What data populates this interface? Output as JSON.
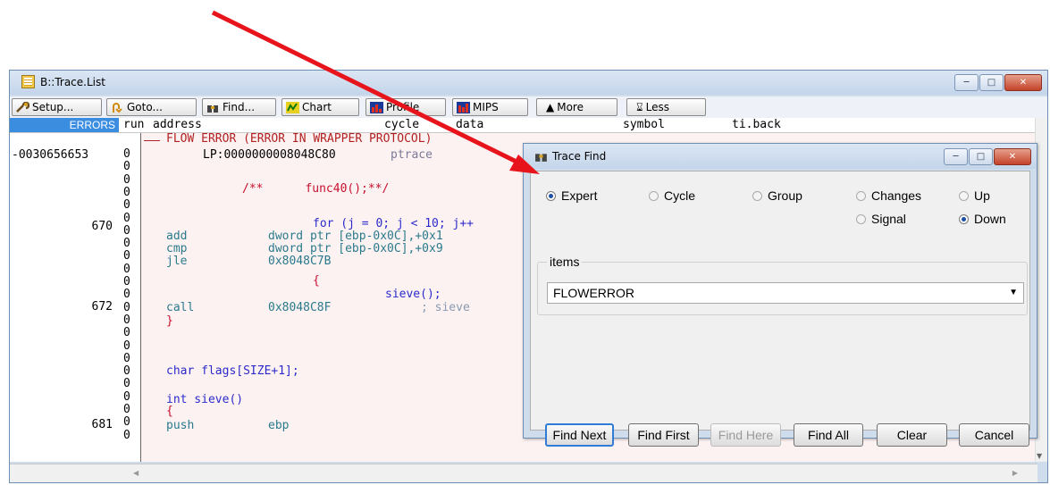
{
  "main_window": {
    "title": "B::Trace.List",
    "toolbar": [
      {
        "label": "Setup...",
        "icon": "wrench-icon"
      },
      {
        "label": "Goto...",
        "icon": "goto-icon"
      },
      {
        "label": "Find...",
        "icon": "binoculars-icon"
      },
      {
        "label": "Chart",
        "icon": "chart-icon"
      },
      {
        "label": "Profile",
        "icon": "profile-icon"
      },
      {
        "label": "MIPS",
        "icon": "mips-icon"
      },
      {
        "label": "More",
        "icon": "up-down-arrow-icon"
      },
      {
        "label": "Less",
        "icon": "hourglass-icon"
      }
    ],
    "columns": {
      "errors": "ERRORS",
      "run": "run",
      "address": "address",
      "cycle": "cycle",
      "data": "data",
      "symbol": "symbol",
      "tiback": "ti.back"
    },
    "flow_error": "FLOW ERROR (ERROR IN WRAPPER PROTOCOL)",
    "left_numbers": [
      "-0030656653",
      "670",
      "672",
      "681"
    ],
    "run_values": [
      "0",
      "0",
      "0",
      "0",
      "0",
      "0",
      "0",
      "0",
      "0",
      "0",
      "0",
      "0",
      "0",
      "0",
      "0",
      "0",
      "0",
      "0",
      "0",
      "0",
      "0",
      "0",
      "0"
    ],
    "code_lines": {
      "lp": "LP:0000000008048C80",
      "lp_sym": "ptrace",
      "comment": "/**      func40();**/",
      "for_stmt": "for (j = 0; j < 10; j++",
      "add_op": "add",
      "add_args": "dword ptr [ebp-0x0C],+0x1",
      "cmp_op": "cmp",
      "cmp_args": "dword ptr [ebp-0x0C],+0x9",
      "jle_op": "jle",
      "jle_args": "0x8048C7B",
      "brace_open_inner": "{",
      "sieve_call": "sieve();",
      "call_op": "call",
      "call_args": "0x8048C8F",
      "call_sym": "; sieve",
      "brace_close": "}",
      "flags_decl": "char flags[SIZE+1];",
      "sieve_decl": "int sieve()",
      "brace_open": "{",
      "push_op": "push",
      "push_args": "ebp"
    }
  },
  "dialog": {
    "title": "Trace Find",
    "radios_row1": [
      {
        "label": "Expert",
        "checked": true
      },
      {
        "label": "Cycle",
        "checked": false
      },
      {
        "label": "Group",
        "checked": false
      },
      {
        "label": "Changes",
        "checked": false
      },
      {
        "label": "Up",
        "checked": false
      }
    ],
    "radios_row2": [
      {
        "label": "Signal",
        "checked": false
      },
      {
        "label": "Down",
        "checked": true
      }
    ],
    "items_label": "items",
    "items_value": "FLOWERROR",
    "buttons": [
      "Find Next",
      "Find First",
      "Find Here",
      "Find All",
      "Clear",
      "Cancel"
    ]
  },
  "colors": {
    "arrow": "#e8141c",
    "errors_header": "#3b8de0",
    "flow_error": "#b22222",
    "code_blue": "#2b2bcc",
    "code_red": "#c8102e",
    "asm_teal": "#2a7a8c"
  }
}
